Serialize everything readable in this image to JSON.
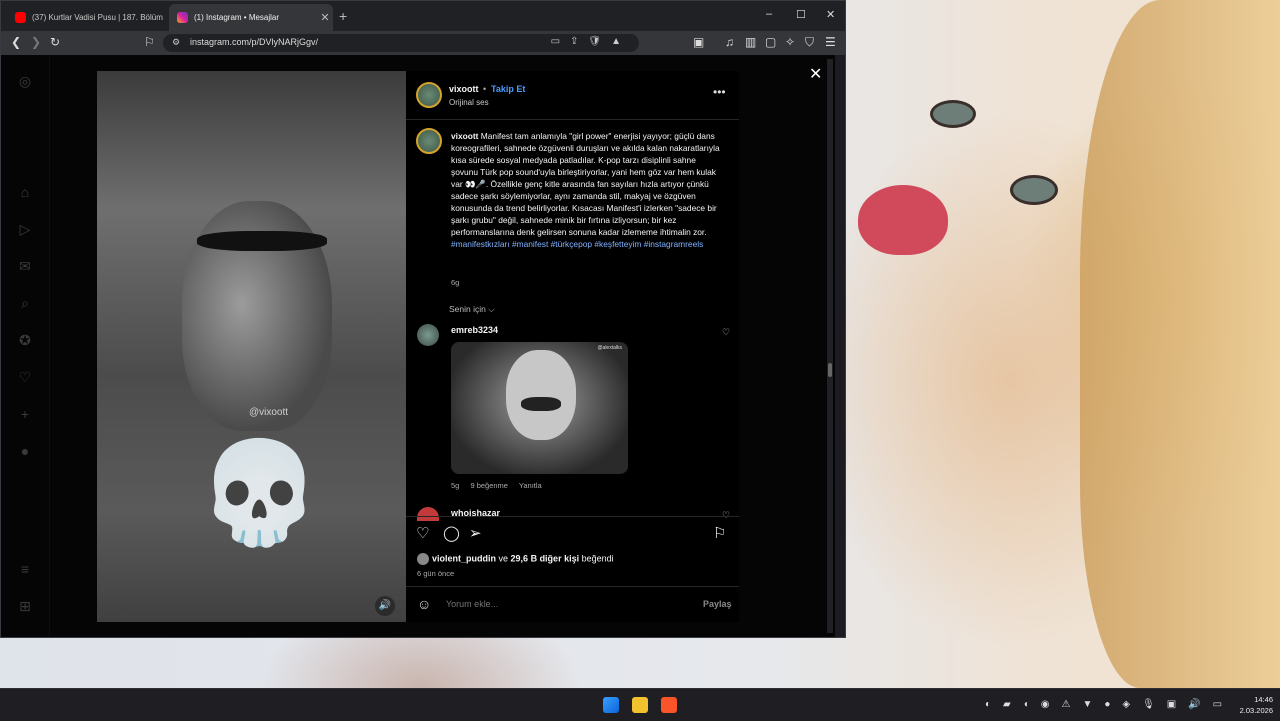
{
  "browser": {
    "tabs": [
      {
        "title": "(37) Kurtlar Vadisi Pusu | 187. Bölüm",
        "favicon_color": "#ff0000"
      },
      {
        "title": "(1) Instagram • Mesajlar",
        "favicon_color": "#d6249f"
      }
    ],
    "new_tab": "+",
    "window_controls": {
      "minimize": "–",
      "maximize": "☐",
      "close": "✕"
    },
    "address": "instagram.com/p/DVlyNARjGgv/"
  },
  "modal": {
    "watermark": "@vixoott",
    "author": "vixoott",
    "dot": "•",
    "follow_label": "Takip Et",
    "audio_label": "Orijinal ses",
    "more_label": "•••",
    "caption": {
      "user": "vixoott",
      "text": "Manifest tam anlamıyla \"girl power\" enerjisi yayıyor; güçlü dans koreografileri, sahnede özgüvenli duruşları ve akılda kalan nakaratlarıyla kısa sürede sosyal medyada patladılar. K-pop tarzı disiplinli sahne şovunu Türk pop sound'uyla birleştiriyorlar, yani hem göz var hem kulak var 👀🎤. Özellikle genç kitle arasında fan sayıları hızla artıyor çünkü sadece şarkı söylemiyorlar, aynı zamanda stil, makyaj ve özgüven konusunda da trend belirliyorlar. Kısacası Manifest'i izlerken \"sadece bir şarkı grubu\" değil, sahnede minik bir fırtına izliyorsun; bir kez performanslarına denk gelirsen sonuna kadar izlememe ihtimalin zor.",
      "hashtags": "#manifestkızları #manifest #türkçepop #keşfetteyim #instagramreels",
      "time": "6g"
    },
    "sort_label": "Senin için ⌵",
    "comments": [
      {
        "user": "emreb3234",
        "time": "5g",
        "likes": "9 beğenme",
        "reply": "Yanıtla",
        "gif_tag": "@alextalks"
      },
      {
        "user": "whoishazar"
      }
    ],
    "likes": {
      "user": "violent_puddin",
      "connector": "ve",
      "others": "29,6 B diğer kişi",
      "suffix": "beğendi"
    },
    "ago": "6 gün önce",
    "comment_placeholder": "Yorum ekle...",
    "share_label": "Paylaş",
    "close_label": "✕"
  },
  "clock": {
    "time": "14:46",
    "date": "2.03.2026"
  },
  "colors": {
    "accent": "#4a9cff",
    "hashtag": "#7fb1ff"
  }
}
